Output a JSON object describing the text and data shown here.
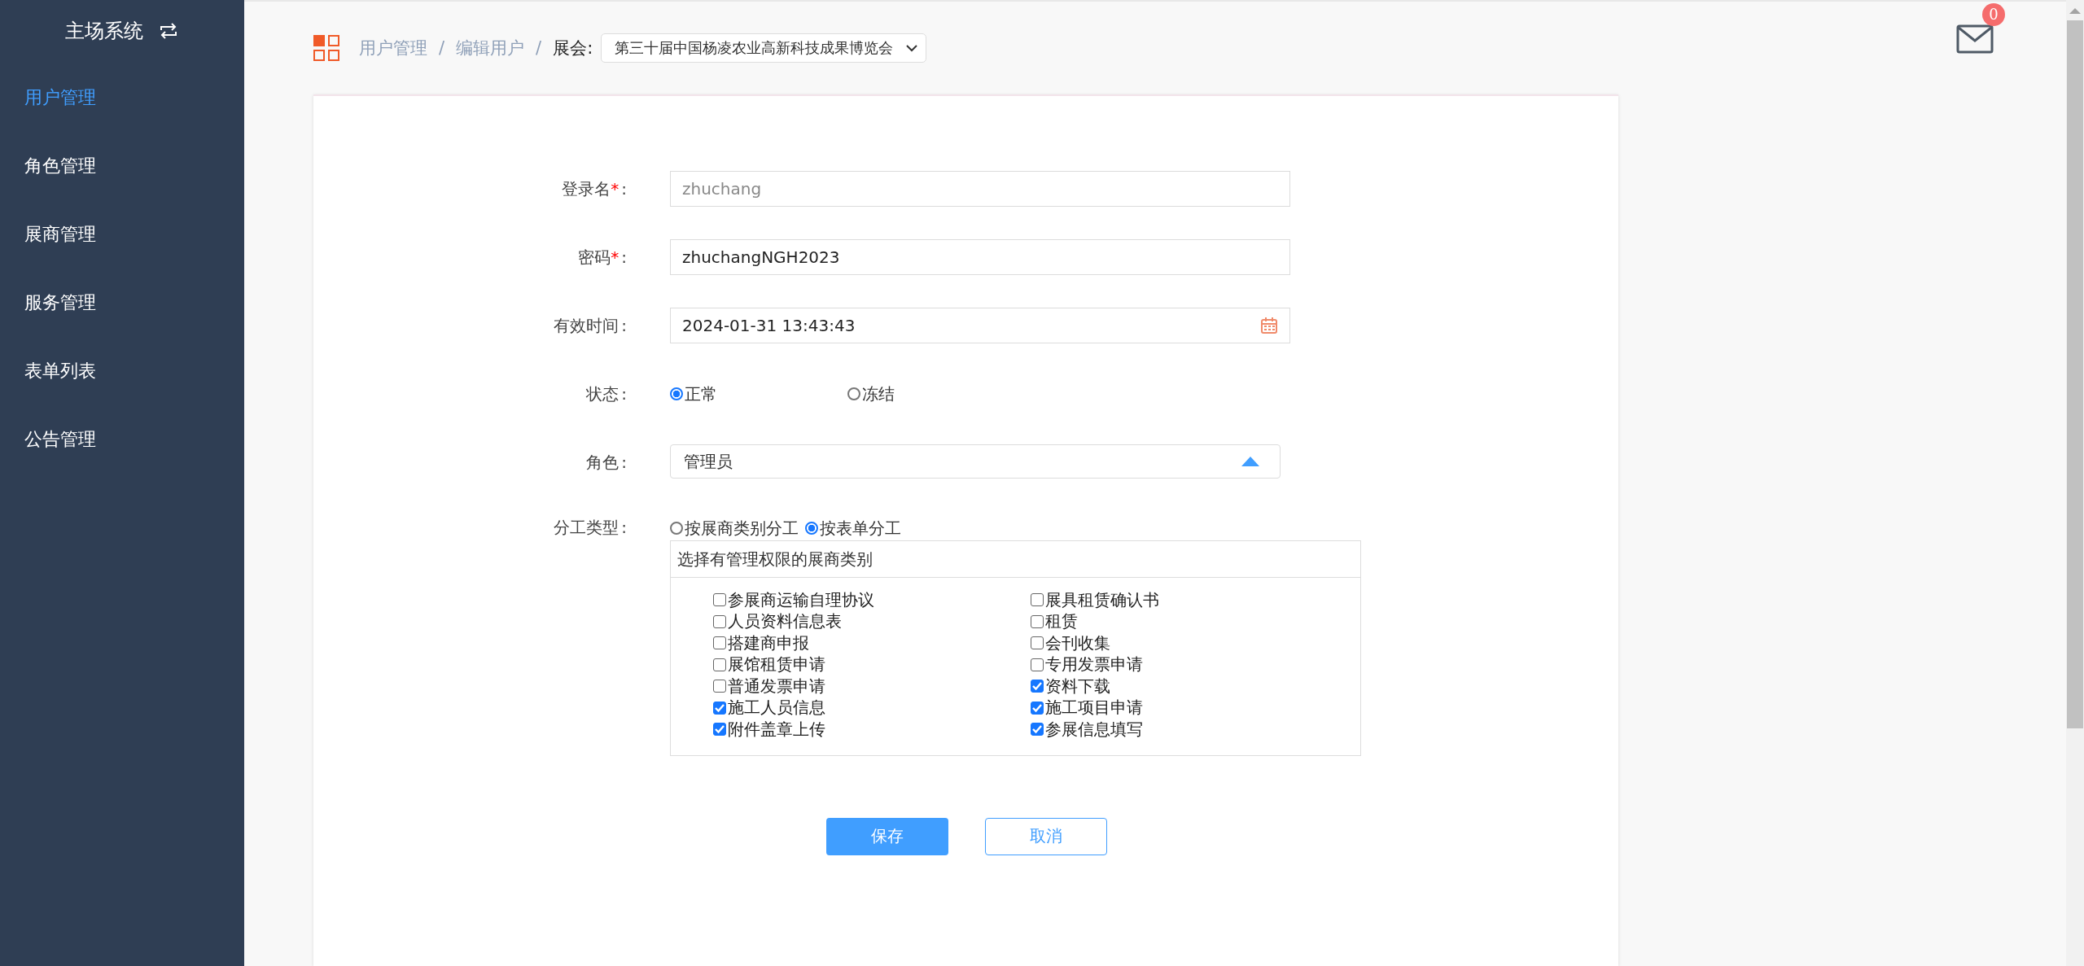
{
  "sidebar": {
    "title": "主场系统",
    "items": [
      {
        "label": "用户管理",
        "selected": true
      },
      {
        "label": "角色管理",
        "selected": false
      },
      {
        "label": "展商管理",
        "selected": false
      },
      {
        "label": "服务管理",
        "selected": false
      },
      {
        "label": "表单列表",
        "selected": false
      },
      {
        "label": "公告管理",
        "selected": false
      }
    ]
  },
  "breadcrumb": [
    {
      "label": "用户管理",
      "separator": "/"
    },
    {
      "label": "编辑用户",
      "separator": "/"
    }
  ],
  "expo_select": {
    "label": "展会:",
    "value": "第三十届中国杨凌农业高新科技成果博览会"
  },
  "mail": {
    "badge": "0"
  },
  "form": {
    "fields": [
      {
        "kind": "text",
        "label": "登录名",
        "required_mark": "*",
        "suffix": ":",
        "value": "zhuchang",
        "disabled": true
      },
      {
        "kind": "text",
        "label": "密码",
        "required_mark": "*",
        "suffix": ":",
        "value": "zhuchangNGH2023",
        "disabled": false
      },
      {
        "kind": "date",
        "label": "有效时间",
        "suffix": ":",
        "value": "2024-01-31 13:43:43",
        "disabled": false
      },
      {
        "kind": "radio",
        "label": "状态",
        "suffix": ":",
        "options": [
          {
            "label": "正常",
            "selected": true
          },
          {
            "label": "冻结",
            "selected": false
          }
        ]
      },
      {
        "kind": "select",
        "label": "角色",
        "suffix": ":",
        "value": "管理员",
        "expanded": true
      },
      {
        "kind": "assign",
        "label": "分工类型",
        "suffix": ":",
        "options": [
          {
            "label": "按展商类别分工",
            "selected": false
          },
          {
            "label": "按表单分工",
            "selected": true
          }
        ],
        "group_title": "选择有管理权限的展商类别",
        "columns": [
          [
            {
              "label": "参展商运输自理协议",
              "checked": false
            },
            {
              "label": "人员资料信息表",
              "checked": false
            },
            {
              "label": "搭建商申报",
              "checked": false
            },
            {
              "label": "展馆租赁申请",
              "checked": false
            },
            {
              "label": "普通发票申请",
              "checked": false
            },
            {
              "label": "施工人员信息",
              "checked": true
            },
            {
              "label": "附件盖章上传",
              "checked": true
            }
          ],
          [
            {
              "label": "展具租赁确认书",
              "checked": false
            },
            {
              "label": "租赁",
              "checked": false
            },
            {
              "label": "会刊收集",
              "checked": false
            },
            {
              "label": "专用发票申请",
              "checked": false
            },
            {
              "label": "资料下载",
              "checked": true
            },
            {
              "label": "施工项目申请",
              "checked": true
            },
            {
              "label": "参展信息填写",
              "checked": true
            }
          ]
        ]
      }
    ],
    "buttons": [
      {
        "kind": "primary",
        "label": "保存"
      },
      {
        "kind": "secondary",
        "label": "取消"
      }
    ]
  }
}
